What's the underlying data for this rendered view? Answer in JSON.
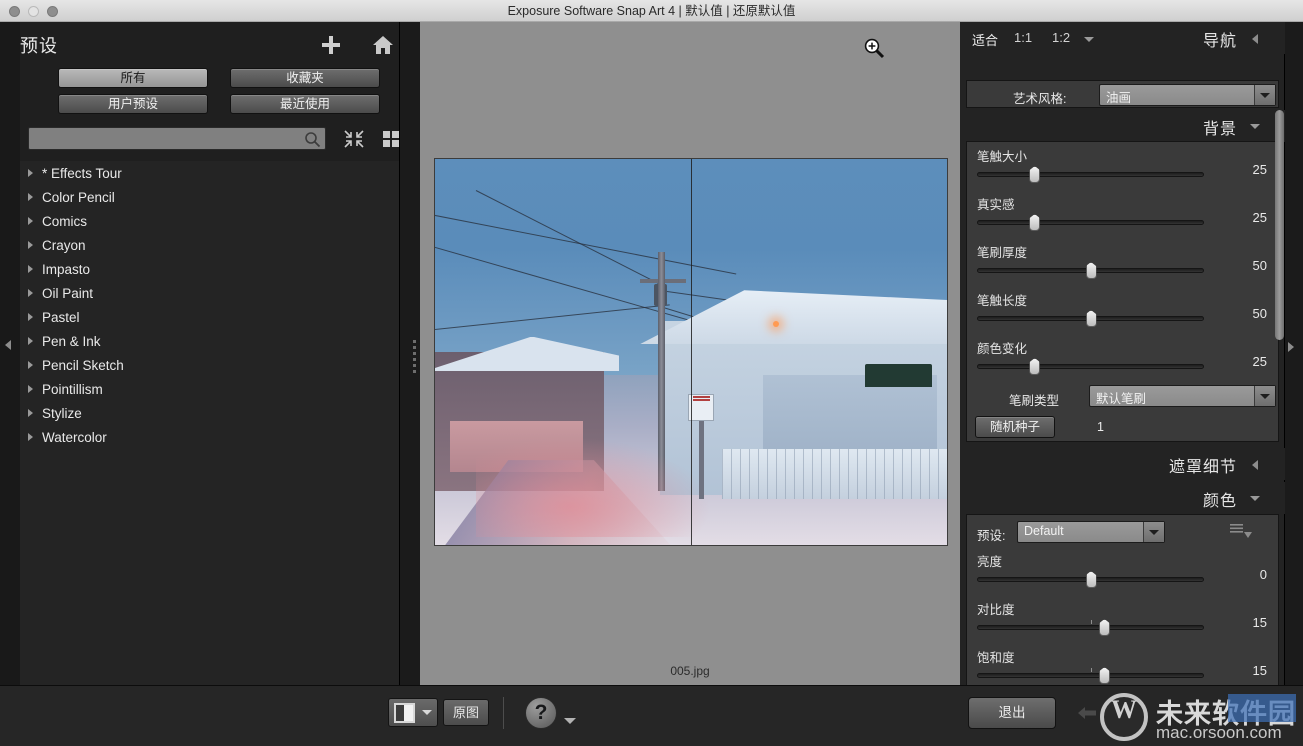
{
  "window": {
    "title": "Exposure Software Snap Art 4 | 默认值 | 还原默认值",
    "traffic": {
      "close": "close-button",
      "min": "minimize-button",
      "max": "maximize-button"
    }
  },
  "left_panel": {
    "title": "预设",
    "add_label": "+",
    "icons": {
      "add": "plus-icon",
      "home": "home-icon",
      "search": "search-icon",
      "collapse": "collapse-all-icon",
      "grid": "grid-view-icon"
    },
    "tabs": [
      {
        "label": "所有",
        "active": true
      },
      {
        "label": "收藏夹",
        "active": false
      },
      {
        "label": "用户预设",
        "active": false
      },
      {
        "label": "最近使用",
        "active": false
      }
    ],
    "search": {
      "value": "",
      "placeholder": ""
    },
    "presets": [
      "* Effects Tour",
      "Color Pencil",
      "Comics",
      "Crayon",
      "Impasto",
      "Oil Paint",
      "Pastel",
      "Pen & Ink",
      "Pencil Sketch",
      "Pointillism",
      "Stylize",
      "Watercolor"
    ]
  },
  "canvas": {
    "filename": "005.jpg",
    "cursor": "zoom-in-cursor",
    "split_preview": true
  },
  "right_panel": {
    "zoom_modes": [
      {
        "label": "适合",
        "active": true
      },
      {
        "label": "1:1",
        "active": false
      },
      {
        "label": "1:2",
        "active": false
      }
    ],
    "nav_title": "导航",
    "style_field": {
      "label": "艺术风格:",
      "value": "油画"
    },
    "sections": [
      {
        "title": "背景",
        "caret": "down",
        "sliders": [
          {
            "label": "笔触大小",
            "value": "25",
            "pct": 25
          },
          {
            "label": "真实感",
            "value": "25",
            "pct": 25
          },
          {
            "label": "笔刷厚度",
            "value": "50",
            "pct": 50
          },
          {
            "label": "笔触长度",
            "value": "50",
            "pct": 50
          },
          {
            "label": "颜色变化",
            "value": "25",
            "pct": 25
          }
        ],
        "brush_field": {
          "label": "笔刷类型",
          "value": "默认笔刷"
        },
        "seed": {
          "button_label": "随机种子",
          "value": "1"
        }
      },
      {
        "title": "遮罩细节",
        "caret": "left"
      },
      {
        "title": "颜色",
        "caret": "down",
        "preset_field": {
          "label": "预设:",
          "value": "Default"
        },
        "sliders": [
          {
            "label": "亮度",
            "value": "0",
            "pct": 50
          },
          {
            "label": "对比度",
            "value": "15",
            "pct": 56,
            "tick": 50
          },
          {
            "label": "饱和度",
            "value": "15",
            "pct": 56,
            "tick": 50
          }
        ]
      }
    ]
  },
  "bottom_bar": {
    "split_icon": "split-view-icon",
    "original_label": "原图",
    "help_label": "?",
    "exit_label": "退出",
    "back_icon": "back-arrow-icon"
  },
  "watermark": {
    "brand_cn": "未来软件园",
    "url": "mac.orsoon.com"
  },
  "colors": {
    "panel_bg": "#232323",
    "group_bg": "#3a3a3a",
    "accent_blue": "#3d6fb5",
    "canvas_bg": "#8f8f8f"
  }
}
